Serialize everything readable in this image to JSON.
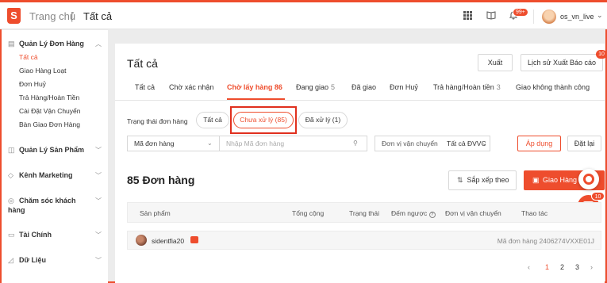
{
  "header": {
    "logo_letter": "S",
    "breadcrumb_home": "Trang chủ",
    "breadcrumb_sep": "|",
    "breadcrumb_current": "Tất cả",
    "notification_badge": "99+",
    "username": "os_vn_live",
    "icons": [
      "apps-grid-icon",
      "book-icon",
      "bell-icon",
      "chevron-down-icon"
    ]
  },
  "sidebar": {
    "orders_section": "Quản Lý Đơn Hàng",
    "order_items": [
      "Tất cả",
      "Giao Hàng Loạt",
      "Đơn Huỷ",
      "Trả Hàng/Hoàn Tiền",
      "Cài Đặt Vận Chuyển",
      "Bàn Giao Đơn Hàng"
    ],
    "products_section": "Quản Lý Sản Phẩm",
    "marketing_section": "Kênh Marketing",
    "customer_care_section": "Chăm sóc khách hàng",
    "finance_section": "Tài Chính",
    "data_section": "Dữ Liệu"
  },
  "main": {
    "title": "Tất cả",
    "export_button": "Xuất",
    "export_history_button": "Lịch sử Xuất Báo cáo",
    "export_history_badge": "10",
    "tabs": [
      {
        "label": "Tất cả",
        "count": ""
      },
      {
        "label": "Chờ xác nhận",
        "count": ""
      },
      {
        "label": "Chờ lấy hàng",
        "count": "86"
      },
      {
        "label": "Đang giao",
        "count": "5"
      },
      {
        "label": "Đã giao",
        "count": ""
      },
      {
        "label": "Đơn Huỷ",
        "count": ""
      },
      {
        "label": "Trả hàng/Hoàn tiền",
        "count": "3"
      },
      {
        "label": "Giao không thành công",
        "count": ""
      }
    ],
    "status_filter_label": "Trạng thái đơn hàng",
    "status_pills": [
      "Tất cả",
      "Chưa xử lý (85)",
      "Đã xử lý (1)"
    ],
    "search_field_select": "Mã đơn hàng",
    "search_placeholder": "Nhập Mã đơn hàng",
    "carrier_label": "Đơn vị vận chuyển",
    "carrier_select": "Tất cả ĐVVC",
    "apply_button": "Áp dụng",
    "reset_button": "Đặt lại",
    "orders_count": "85 Đơn hàng",
    "sort_button": "Sắp xếp theo",
    "ship_button": "Giao Hàng",
    "float_badge": "10",
    "table_headers": [
      "Sản phẩm",
      "Tổng cộng",
      "Trạng thái",
      "Đếm ngược",
      "Đơn vị vận chuyển",
      "Thao tác"
    ],
    "order_row": {
      "seller": "sidentfia20",
      "order_id": "Mã đơn hàng 2406274VXXE01J"
    },
    "pagination": [
      "‹",
      "1",
      "2",
      "3",
      "›"
    ]
  },
  "colors": {
    "accent": "#ee4d2d"
  }
}
